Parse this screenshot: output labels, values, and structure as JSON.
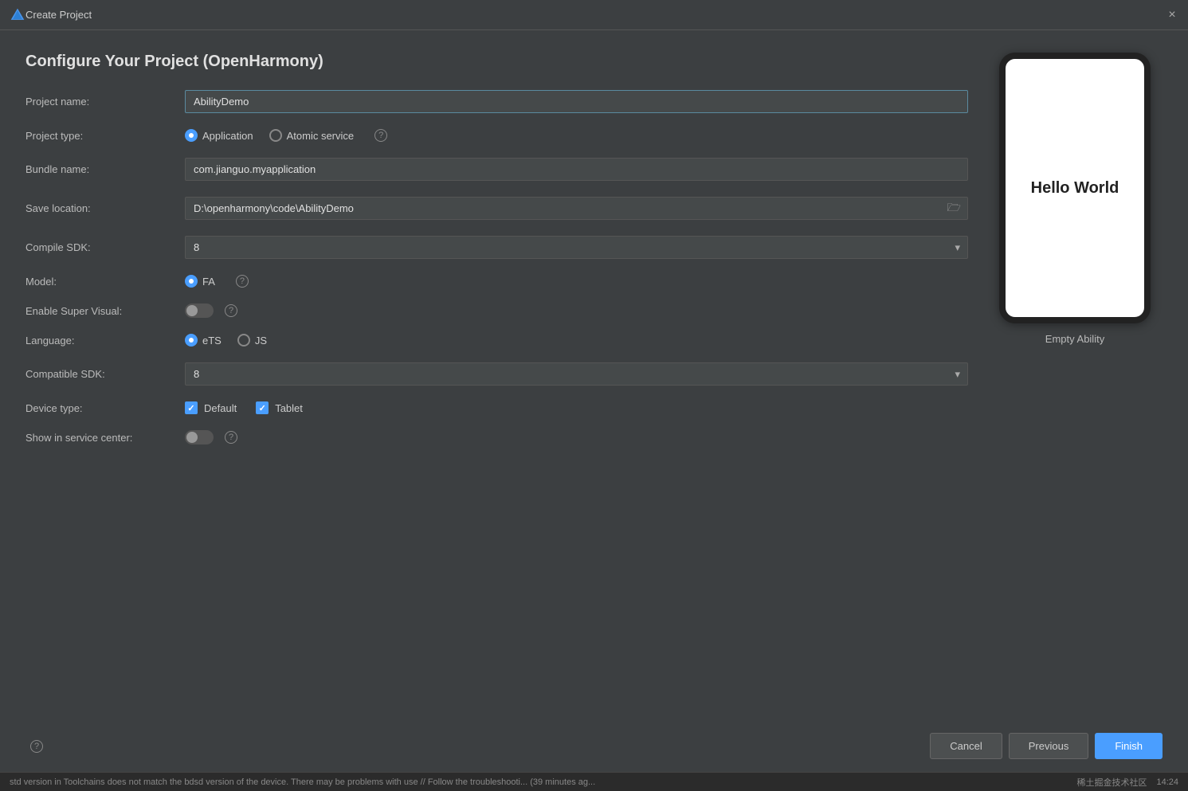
{
  "titleBar": {
    "title": "Create Project",
    "closeLabel": "×"
  },
  "dialog": {
    "heading": "Configure Your Project (OpenHarmony)"
  },
  "form": {
    "projectNameLabel": "Project name:",
    "projectNameValue": "AbilityDemo",
    "projectTypeLable": "Project type:",
    "projectTypeApplication": "Application",
    "projectTypeAtomicService": "Atomic service",
    "bundleNameLabel": "Bundle name:",
    "bundleNameValue": "com.jianguo.myapplication",
    "saveLocationLabel": "Save location:",
    "saveLocationValue": "D:\\openharmony\\code\\AbilityDemo",
    "compileSDKLabel": "Compile SDK:",
    "compileSDKValue": "8",
    "modelLabel": "Model:",
    "modelFA": "FA",
    "enableSuperVisualLabel": "Enable Super Visual:",
    "languageLabel": "Language:",
    "languageETS": "eTS",
    "languageJS": "JS",
    "compatibleSDKLabel": "Compatible SDK:",
    "compatibleSDKValue": "8",
    "deviceTypeLabel": "Device type:",
    "deviceTypeDefault": "Default",
    "deviceTypeTablet": "Tablet",
    "showInServiceCenterLabel": "Show in service center:"
  },
  "preview": {
    "helloWorld": "Hello World",
    "label": "Empty Ability"
  },
  "buttons": {
    "helpLabel": "?",
    "cancelLabel": "Cancel",
    "previousLabel": "Previous",
    "finishLabel": "Finish"
  },
  "statusBar": {
    "text": "std version in Toolchains does not match the bdsd version of the device. There may be problems with use // Follow the troubleshooti... (39 minutes ag...",
    "time": "14:24",
    "community": "稀土掘金技术社区"
  }
}
